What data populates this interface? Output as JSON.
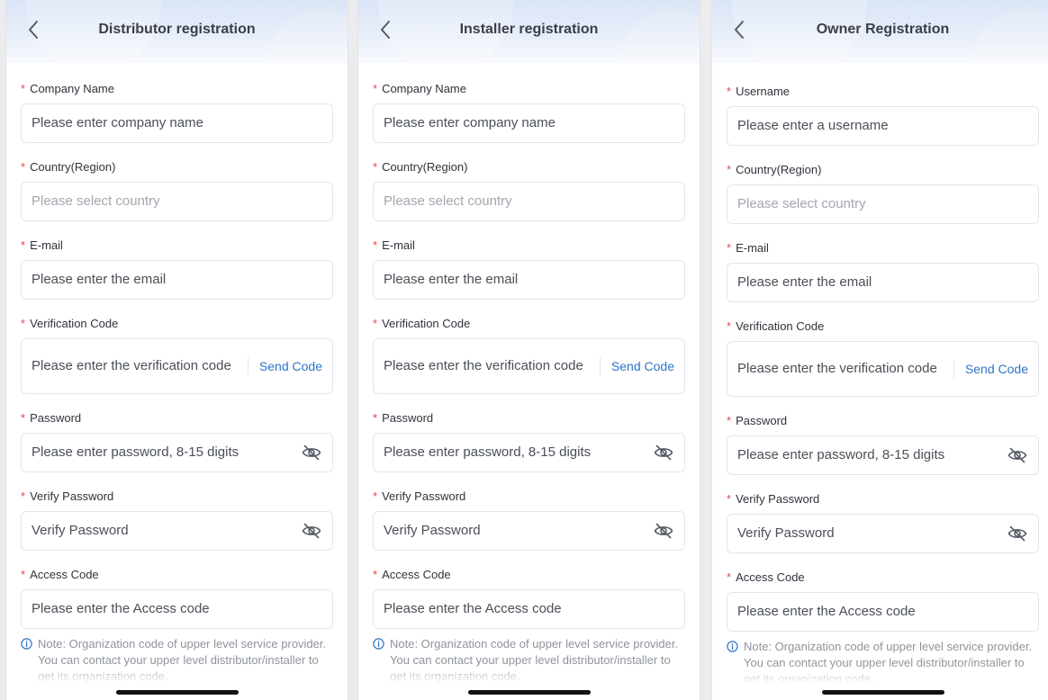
{
  "panels": [
    {
      "title": "Distributor registration",
      "fields": [
        {
          "label": "Company Name",
          "placeholder": "Please enter company name"
        },
        {
          "label": "Country(Region)",
          "placeholder": "Please select country"
        },
        {
          "label": "E-mail",
          "placeholder": "Please enter the email"
        },
        {
          "label": "Verification Code",
          "placeholder": "Please enter the verification code",
          "action": "Send Code"
        },
        {
          "label": "Password",
          "placeholder": "Please enter password, 8-15 digits"
        },
        {
          "label": "Verify Password",
          "placeholder": "Verify Password"
        },
        {
          "label": "Access Code",
          "placeholder": "Please enter the Access code"
        }
      ],
      "note": "Note: Organization code of upper level service provider. You can contact your upper level distributor/installer to get its organization code."
    },
    {
      "title": "Installer registration",
      "fields": [
        {
          "label": "Company Name",
          "placeholder": "Please enter company name"
        },
        {
          "label": "Country(Region)",
          "placeholder": "Please select country"
        },
        {
          "label": "E-mail",
          "placeholder": "Please enter the email"
        },
        {
          "label": "Verification Code",
          "placeholder": "Please enter the verification code",
          "action": "Send Code"
        },
        {
          "label": "Password",
          "placeholder": "Please enter password, 8-15 digits"
        },
        {
          "label": "Verify Password",
          "placeholder": "Verify Password"
        },
        {
          "label": "Access Code",
          "placeholder": "Please enter the Access code"
        }
      ],
      "note": "Note: Organization code of upper level service provider. You can contact your upper level distributor/installer to get its organization code."
    },
    {
      "title": "Owner Registration",
      "fields": [
        {
          "label": "Username",
          "placeholder": "Please enter a username"
        },
        {
          "label": "Country(Region)",
          "placeholder": "Please select country"
        },
        {
          "label": "E-mail",
          "placeholder": "Please enter the email"
        },
        {
          "label": "Verification Code",
          "placeholder": "Please enter the verification code",
          "action": "Send Code"
        },
        {
          "label": "Password",
          "placeholder": "Please enter password, 8-15 digits"
        },
        {
          "label": "Verify Password",
          "placeholder": "Verify Password"
        },
        {
          "label": "Access Code",
          "placeholder": "Please enter the Access code"
        }
      ],
      "note": "Note: Organization code of upper level service provider. You can contact your upper level distributor/installer to get its organization code."
    }
  ],
  "required_marker": "*",
  "icons": {
    "back": "chevron-left-icon",
    "eye": "eye-slash-icon",
    "info": "info-icon"
  },
  "colors": {
    "required": "#e5484d",
    "link": "#2f73c9",
    "header": "#dce6f7"
  }
}
